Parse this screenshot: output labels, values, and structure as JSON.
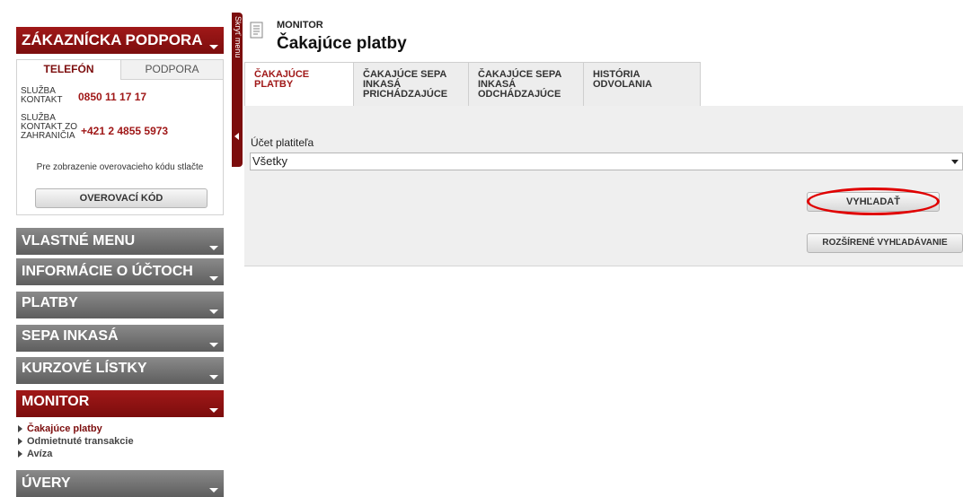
{
  "sidebar": {
    "customer_support": {
      "title": "ZÁKAZNÍCKA PODPORA"
    },
    "support_tabs": [
      {
        "label": "TELEFÓN"
      },
      {
        "label": "PODPORA"
      }
    ],
    "phones": [
      {
        "label": "SLUŽBA KONTAKT",
        "number": "0850 11 17 17"
      },
      {
        "label": "SLUŽBA KONTAKT ZO ZAHRANIČIA",
        "number": "+421 2 4855 5973"
      }
    ],
    "verify_text": "Pre zobrazenie overovacieho kódu stlačte",
    "verify_button": "OVEROVACÍ KÓD",
    "menus": [
      {
        "label": "VLASTNÉ MENU"
      },
      {
        "label": "INFORMÁCIE O ÚČTOCH"
      },
      {
        "label": "PLATBY"
      },
      {
        "label": "SEPA INKASÁ"
      },
      {
        "label": "KURZOVÉ LÍSTKY"
      },
      {
        "label": "MONITOR"
      },
      {
        "label": "ÚVERY"
      }
    ],
    "monitor_items": [
      {
        "label": "Čakajúce platby"
      },
      {
        "label": "Odmietnuté transakcie"
      },
      {
        "label": "Avíza"
      }
    ],
    "hide_menu": "Skryť menu"
  },
  "main": {
    "breadcrumb": "MONITOR",
    "title": "Čakajúce platby",
    "tabs": [
      {
        "label": "ČAKAJÚCE PLATBY"
      },
      {
        "label": "ČAKAJÚCE SEPA INKASÁ PRICHÁDZAJÚCE"
      },
      {
        "label": "ČAKAJÚCE SEPA INKASÁ ODCHÁDZAJÚCE"
      },
      {
        "label": "HISTÓRIA ODVOLANIA"
      }
    ],
    "payer_account_label": "Účet platiteľa",
    "payer_account_value": "Všetky",
    "search_button": "VYHĽADAŤ",
    "advanced_search_button": "ROZŠÍRENÉ VYHĽADÁVANIE"
  },
  "colors": {
    "brand_red": "#7c0d0d",
    "highlight_oval": "#e00000"
  }
}
